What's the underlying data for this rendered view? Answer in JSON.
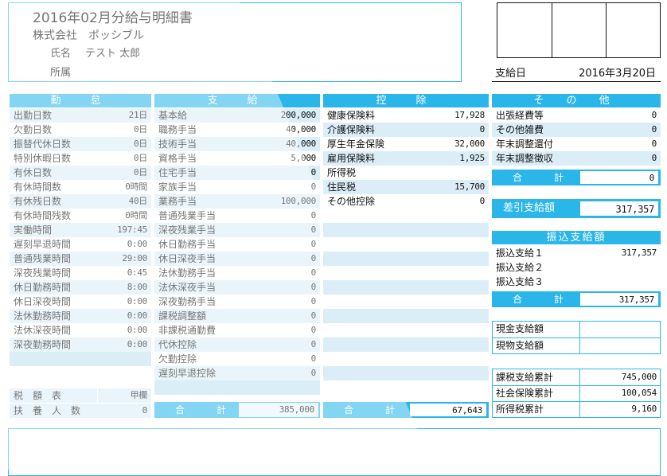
{
  "header": {
    "title": "2016年02月分給与明細書",
    "company": "株式会社　ポッシブル",
    "name_label": "氏名",
    "name_value": "テスト 太郎",
    "dept_label": "所属",
    "pay_date_label": "支給日",
    "pay_date_value": "2016年3月20日"
  },
  "attendance": {
    "title": "勤　怠",
    "rows": [
      {
        "label": "出勤日数",
        "value": "21日"
      },
      {
        "label": "欠勤日数",
        "value": "0日"
      },
      {
        "label": "振替代休日数",
        "value": "0日"
      },
      {
        "label": "特別休暇日数",
        "value": "0日"
      },
      {
        "label": "有休日数",
        "value": "0日"
      },
      {
        "label": "有休時間数",
        "value": "0時間"
      },
      {
        "label": "有休残日数",
        "value": "40日"
      },
      {
        "label": "有休時間残数",
        "value": "0時間"
      },
      {
        "label": "実働時間",
        "value": "197:45"
      },
      {
        "label": "遅刻早退時間",
        "value": "0:00"
      },
      {
        "label": "普通残業時間",
        "value": "29:00"
      },
      {
        "label": "深夜残業時間",
        "value": "0:45"
      },
      {
        "label": "休日勤務時間",
        "value": "8:00"
      },
      {
        "label": "休日深夜時間",
        "value": "0:00"
      },
      {
        "label": "法休勤務時間",
        "value": "0:00"
      },
      {
        "label": "法休深夜時間",
        "value": "0:00"
      },
      {
        "label": "深夜勤務時間",
        "value": "0:00"
      }
    ],
    "tax_table_label": "税　額　表",
    "tax_table_value": "甲欄",
    "dependents_label": "扶　養　人　数",
    "dependents_value": "0"
  },
  "payments": {
    "title": "支　給",
    "rows": [
      {
        "label": "基本給",
        "value": "200,000"
      },
      {
        "label": "職務手当",
        "value": "40,000"
      },
      {
        "label": "技術手当",
        "value": "40,000"
      },
      {
        "label": "資格手当",
        "value": "5,000"
      },
      {
        "label": "住宅手当",
        "value": "0"
      },
      {
        "label": "家族手当",
        "value": "0"
      },
      {
        "label": "業務手当",
        "value": "100,000"
      },
      {
        "label": "普通残業手当",
        "value": "0"
      },
      {
        "label": "深夜残業手当",
        "value": "0"
      },
      {
        "label": "休日勤務手当",
        "value": "0"
      },
      {
        "label": "休日深夜手当",
        "value": "0"
      },
      {
        "label": "法休勤務手当",
        "value": "0"
      },
      {
        "label": "法休深夜手当",
        "value": "0"
      },
      {
        "label": "深夜勤務手当",
        "value": "0"
      },
      {
        "label": "課税調整額",
        "value": "0"
      },
      {
        "label": "非課税通勤費",
        "value": "0"
      },
      {
        "label": "代休控除",
        "value": "0"
      },
      {
        "label": "欠勤控除",
        "value": "0"
      },
      {
        "label": "遅刻早退控除",
        "value": "0"
      }
    ],
    "total_label": "合　計",
    "total_value": "385,000"
  },
  "deductions": {
    "title": "控　除",
    "rows": [
      {
        "label": "健康保険料",
        "value": "17,928"
      },
      {
        "label": "介護保険料",
        "value": "0"
      },
      {
        "label": "厚生年金保険",
        "value": "32,000"
      },
      {
        "label": "雇用保険料",
        "value": "1,925"
      },
      {
        "label": "所得税",
        "value": ""
      },
      {
        "label": "住民税",
        "value": "15,700"
      },
      {
        "label": "その他控除",
        "value": "0"
      }
    ],
    "total_label": "合　計",
    "total_value": "67,643"
  },
  "other": {
    "title": "そ の 他",
    "rows": [
      {
        "label": "出張経費等",
        "value": "0"
      },
      {
        "label": "その他雑費",
        "value": "0"
      },
      {
        "label": "年末調整還付",
        "value": "0"
      },
      {
        "label": "年末調整徴収",
        "value": "0"
      }
    ],
    "total_label": "合　計",
    "total_value": "0",
    "net_pay_label": "差引支給額",
    "net_pay_value": "317,357",
    "transfer_title": "振込支給額",
    "transfers": [
      {
        "label": "振込支給１",
        "value": "317,357"
      },
      {
        "label": "振込支給２",
        "value": ""
      },
      {
        "label": "振込支給３",
        "value": ""
      }
    ],
    "transfer_total_label": "合　計",
    "transfer_total_value": "317,357",
    "cash_label": "現金支給額",
    "cash_value": "",
    "goods_label": "現物支給額",
    "goods_value": "",
    "taxable_cum_label": "課税支給累計",
    "taxable_cum_value": "745,000",
    "social_cum_label": "社会保険累計",
    "social_cum_value": "100,054",
    "income_tax_cum_label": "所得税累計",
    "income_tax_cum_value": "9,160"
  },
  "colors": {
    "accent": "#2bb6ea",
    "shade": "#dbeef8"
  }
}
